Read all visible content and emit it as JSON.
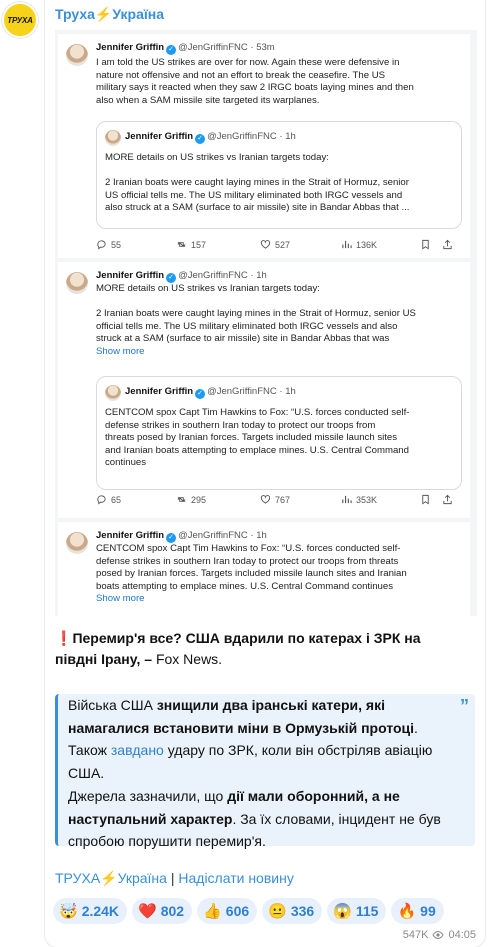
{
  "channel": {
    "name": "Труха⚡Україна",
    "avatar_text": "ТРУХА"
  },
  "tweets": [
    {
      "name": "Jennifer Griffin",
      "handle": "@JenGriffinFNC",
      "time": "53m",
      "lines": [
        "I am told the US strikes are over for now. Again these were defensive in",
        "nature not offensive and not an effort to break the ceasefire. The US",
        "military says it reacted when they saw 2 IRGC boats laying mines and then",
        "also when a SAM missile site targeted its warplanes."
      ],
      "quote": {
        "name": "Jennifer Griffin",
        "handle": "@JenGriffinFNC",
        "time": "1h",
        "lines": [
          "MORE details on US strikes vs Iranian targets today:",
          "",
          "2 Iranian boats were caught laying mines in the Strait of Hormuz, senior",
          "US official tells me. The US military eliminated both IRGC vessels and",
          "also struck at a SAM (surface to air missile) site in Bandar Abbas that ..."
        ]
      },
      "stats": {
        "replies": "55",
        "retweets": "157",
        "likes": "527",
        "views": "136K"
      }
    },
    {
      "name": "Jennifer Griffin",
      "handle": "@JenGriffinFNC",
      "time": "1h",
      "lines": [
        "MORE details on US strikes vs Iranian targets today:",
        "",
        "2 Iranian boats were caught laying mines in the Strait of Hormuz, senior US",
        "official tells me. The US military eliminated both IRGC vessels and also",
        "struck at a SAM (surface to air missile) site in Bandar Abbas that was"
      ],
      "more": "Show more",
      "quote": {
        "name": "Jennifer Griffin",
        "handle": "@JenGriffinFNC",
        "time": "1h",
        "lines": [
          "CENTCOM spox Capt Tim Hawkins to Fox: “U.S. forces conducted self-",
          "defense strikes in southern Iran today to protect our troops from",
          "threats posed by Iranian forces. Targets included missile launch sites",
          "and Iranian boats attempting to emplace mines. U.S. Central Command",
          "continues"
        ]
      },
      "stats": {
        "replies": "65",
        "retweets": "295",
        "likes": "767",
        "views": "353K"
      }
    },
    {
      "name": "Jennifer Griffin",
      "handle": "@JenGriffinFNC",
      "time": "1h",
      "lines": [
        "CENTCOM spox Capt Tim Hawkins to Fox: “U.S. forces conducted self-",
        "defense strikes in southern Iran today to protect our troops from threats",
        "posed by Iranian forces. Targets included missile launch sites and Iranian",
        "boats attempting to emplace mines. U.S. Central Command continues"
      ],
      "more": "Show more"
    }
  ],
  "headline": {
    "mark": "❗",
    "bold": "Перемир'я все? США вдарили по катерах і ЗРК на півдні Ірану, –",
    "tail": " Fox News."
  },
  "quote_block": {
    "p1_a": "Війська США ",
    "p1_b": "знищили два іранські катери, які намагалися встановити міни в Ормузькій протоці",
    "p1_c": ".",
    "p2_a": "Також ",
    "p2_link": "завдано",
    "p2_c": " удару по ЗРК, коли він обстріляв авіацію США.",
    "p3_a": "Джерела зазначили, що ",
    "p3_b": "дії мали оборонний, а не наступальний характер",
    "p3_c": ". За їх словами, інцидент не був спробою порушити перемир'я."
  },
  "signature": {
    "channel": "ТРУХА⚡Україна",
    "separator": " | ",
    "submit": "Надіслати новину"
  },
  "reactions": [
    {
      "emoji": "🤯",
      "count": "2.24K"
    },
    {
      "emoji": "❤️",
      "count": "802"
    },
    {
      "emoji": "👍",
      "count": "606"
    },
    {
      "emoji": "😐",
      "count": "336"
    },
    {
      "emoji": "😱",
      "count": "115"
    },
    {
      "emoji": "🔥",
      "count": "99"
    }
  ],
  "meta": {
    "views": "547K",
    "time": "04:05"
  },
  "colors": {
    "accent": "#3a8fd8",
    "reaction_bg": "#e8f1fb",
    "quote_bg": "#eaf3fb"
  }
}
